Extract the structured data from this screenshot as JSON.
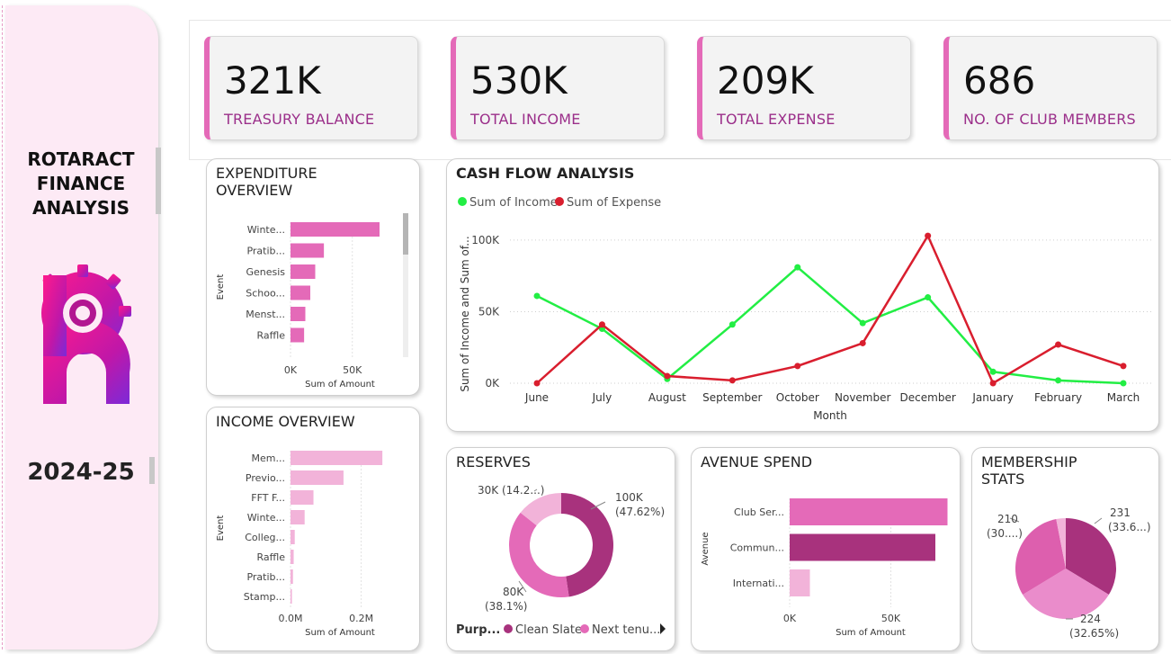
{
  "sidebar": {
    "title_lines": [
      "ROTARACT",
      "FINANCE",
      "ANALYSIS"
    ],
    "year": "2024-25",
    "logo": "rotaract-gear-logo"
  },
  "kpis": [
    {
      "value": "321K",
      "label": "TREASURY BALANCE"
    },
    {
      "value": "530K",
      "label": "TOTAL INCOME"
    },
    {
      "value": "209K",
      "label": "TOTAL EXPENSE"
    },
    {
      "value": "686",
      "label": "NO. OF CLUB MEMBERS"
    }
  ],
  "colors": {
    "accent": "#e46ab8",
    "income": "#22ee44",
    "expense": "#d91e2e",
    "plum": "#a8327d",
    "pink": "#e46ab8",
    "lightpink": "#f2b3d9",
    "kpi_label": "#9b2f8a"
  },
  "chart_data": [
    {
      "id": "expenditure",
      "type": "bar",
      "orientation": "horizontal",
      "title": "EXPENDITURE OVERVIEW",
      "ylabel": "Event",
      "xlabel": "Sum of Amount",
      "categories": [
        "Winte...",
        "Pratib...",
        "Genesis",
        "Schoo...",
        "Menst...",
        "Raffle"
      ],
      "values": [
        72000,
        27000,
        20000,
        16000,
        12000,
        11000
      ],
      "xlim": [
        0,
        80000
      ],
      "xticks": [
        0,
        50000
      ],
      "xtick_labels": [
        "0K",
        "50K"
      ],
      "color": "#e46ab8"
    },
    {
      "id": "income",
      "type": "bar",
      "orientation": "horizontal",
      "title": "INCOME OVERVIEW",
      "ylabel": "Event",
      "xlabel": "Sum of Amount",
      "categories": [
        "Mem...",
        "Previo...",
        "FFT F...",
        "Winte...",
        "Colleg...",
        "Raffle",
        "Pratib...",
        "Stamp..."
      ],
      "values": [
        260000,
        150000,
        65000,
        40000,
        12000,
        9000,
        7000,
        4000
      ],
      "xlim": [
        0,
        280000
      ],
      "xticks": [
        0,
        200000
      ],
      "xtick_labels": [
        "0.0M",
        "0.2M"
      ],
      "color": "#f2b3d9"
    },
    {
      "id": "cashflow",
      "type": "line",
      "title": "CASH FLOW ANALYSIS",
      "xlabel": "Month",
      "ylabel": "Sum of Income and Sum of...",
      "x": [
        "June",
        "July",
        "August",
        "September",
        "October",
        "November",
        "December",
        "January",
        "February",
        "March"
      ],
      "series": [
        {
          "name": "Sum of Income",
          "color": "#22ee44",
          "values": [
            61000,
            38000,
            3000,
            41000,
            81000,
            42000,
            60000,
            8000,
            2000,
            0
          ]
        },
        {
          "name": "Sum of Expense",
          "color": "#d91e2e",
          "values": [
            0,
            41000,
            5000,
            2000,
            12000,
            28000,
            103000,
            0,
            27000,
            12000
          ]
        }
      ],
      "ylim": [
        0,
        110000
      ],
      "yticks": [
        0,
        50000,
        100000
      ],
      "ytick_labels": [
        "0K",
        "50K",
        "100K"
      ],
      "legend": "top-left",
      "grid": true
    },
    {
      "id": "reserves",
      "type": "pie",
      "donut": true,
      "title": "RESERVES",
      "legend_title": "Purp...",
      "legend_items": [
        {
          "name": "Clean Slate",
          "color": "#a8327d"
        },
        {
          "name": "Next tenu...",
          "color": "#e46ab8"
        }
      ],
      "slices": [
        {
          "label": "100K",
          "pct_label": "(47.62%)",
          "value": 100000,
          "color": "#a8327d"
        },
        {
          "label": "80K",
          "pct_label": "(38.1%)",
          "value": 80000,
          "color": "#e46ab8"
        },
        {
          "label": "30K",
          "pct_label": "(14.2...)",
          "value": 30000,
          "color": "#f2b3d9"
        }
      ]
    },
    {
      "id": "avenue",
      "type": "bar",
      "orientation": "horizontal",
      "title": "AVENUE SPEND",
      "ylabel": "Avenue",
      "xlabel": "Sum of Amount",
      "categories": [
        "Club Ser...",
        "Commun...",
        "Internati..."
      ],
      "values": [
        78000,
        72000,
        10000
      ],
      "bar_colors": [
        "#e46ab8",
        "#a8327d",
        "#f2b3d9"
      ],
      "xlim": [
        0,
        80000
      ],
      "xticks": [
        0,
        50000
      ],
      "xtick_labels": [
        "0K",
        "50K"
      ]
    },
    {
      "id": "membership",
      "type": "pie",
      "title": "MEMBERSHIP STATS",
      "slices": [
        {
          "label": "231",
          "pct_label": "(33.6...)",
          "value": 231,
          "color": "#a8327d"
        },
        {
          "label": "224",
          "pct_label": "(32.65%)",
          "value": 224,
          "color": "#ea8ccb"
        },
        {
          "label": "210",
          "pct_label": "(30....)",
          "value": 210,
          "color": "#dd5fae"
        },
        {
          "label": "",
          "pct_label": "",
          "value": 21,
          "color": "#f2b3d9"
        }
      ]
    }
  ]
}
